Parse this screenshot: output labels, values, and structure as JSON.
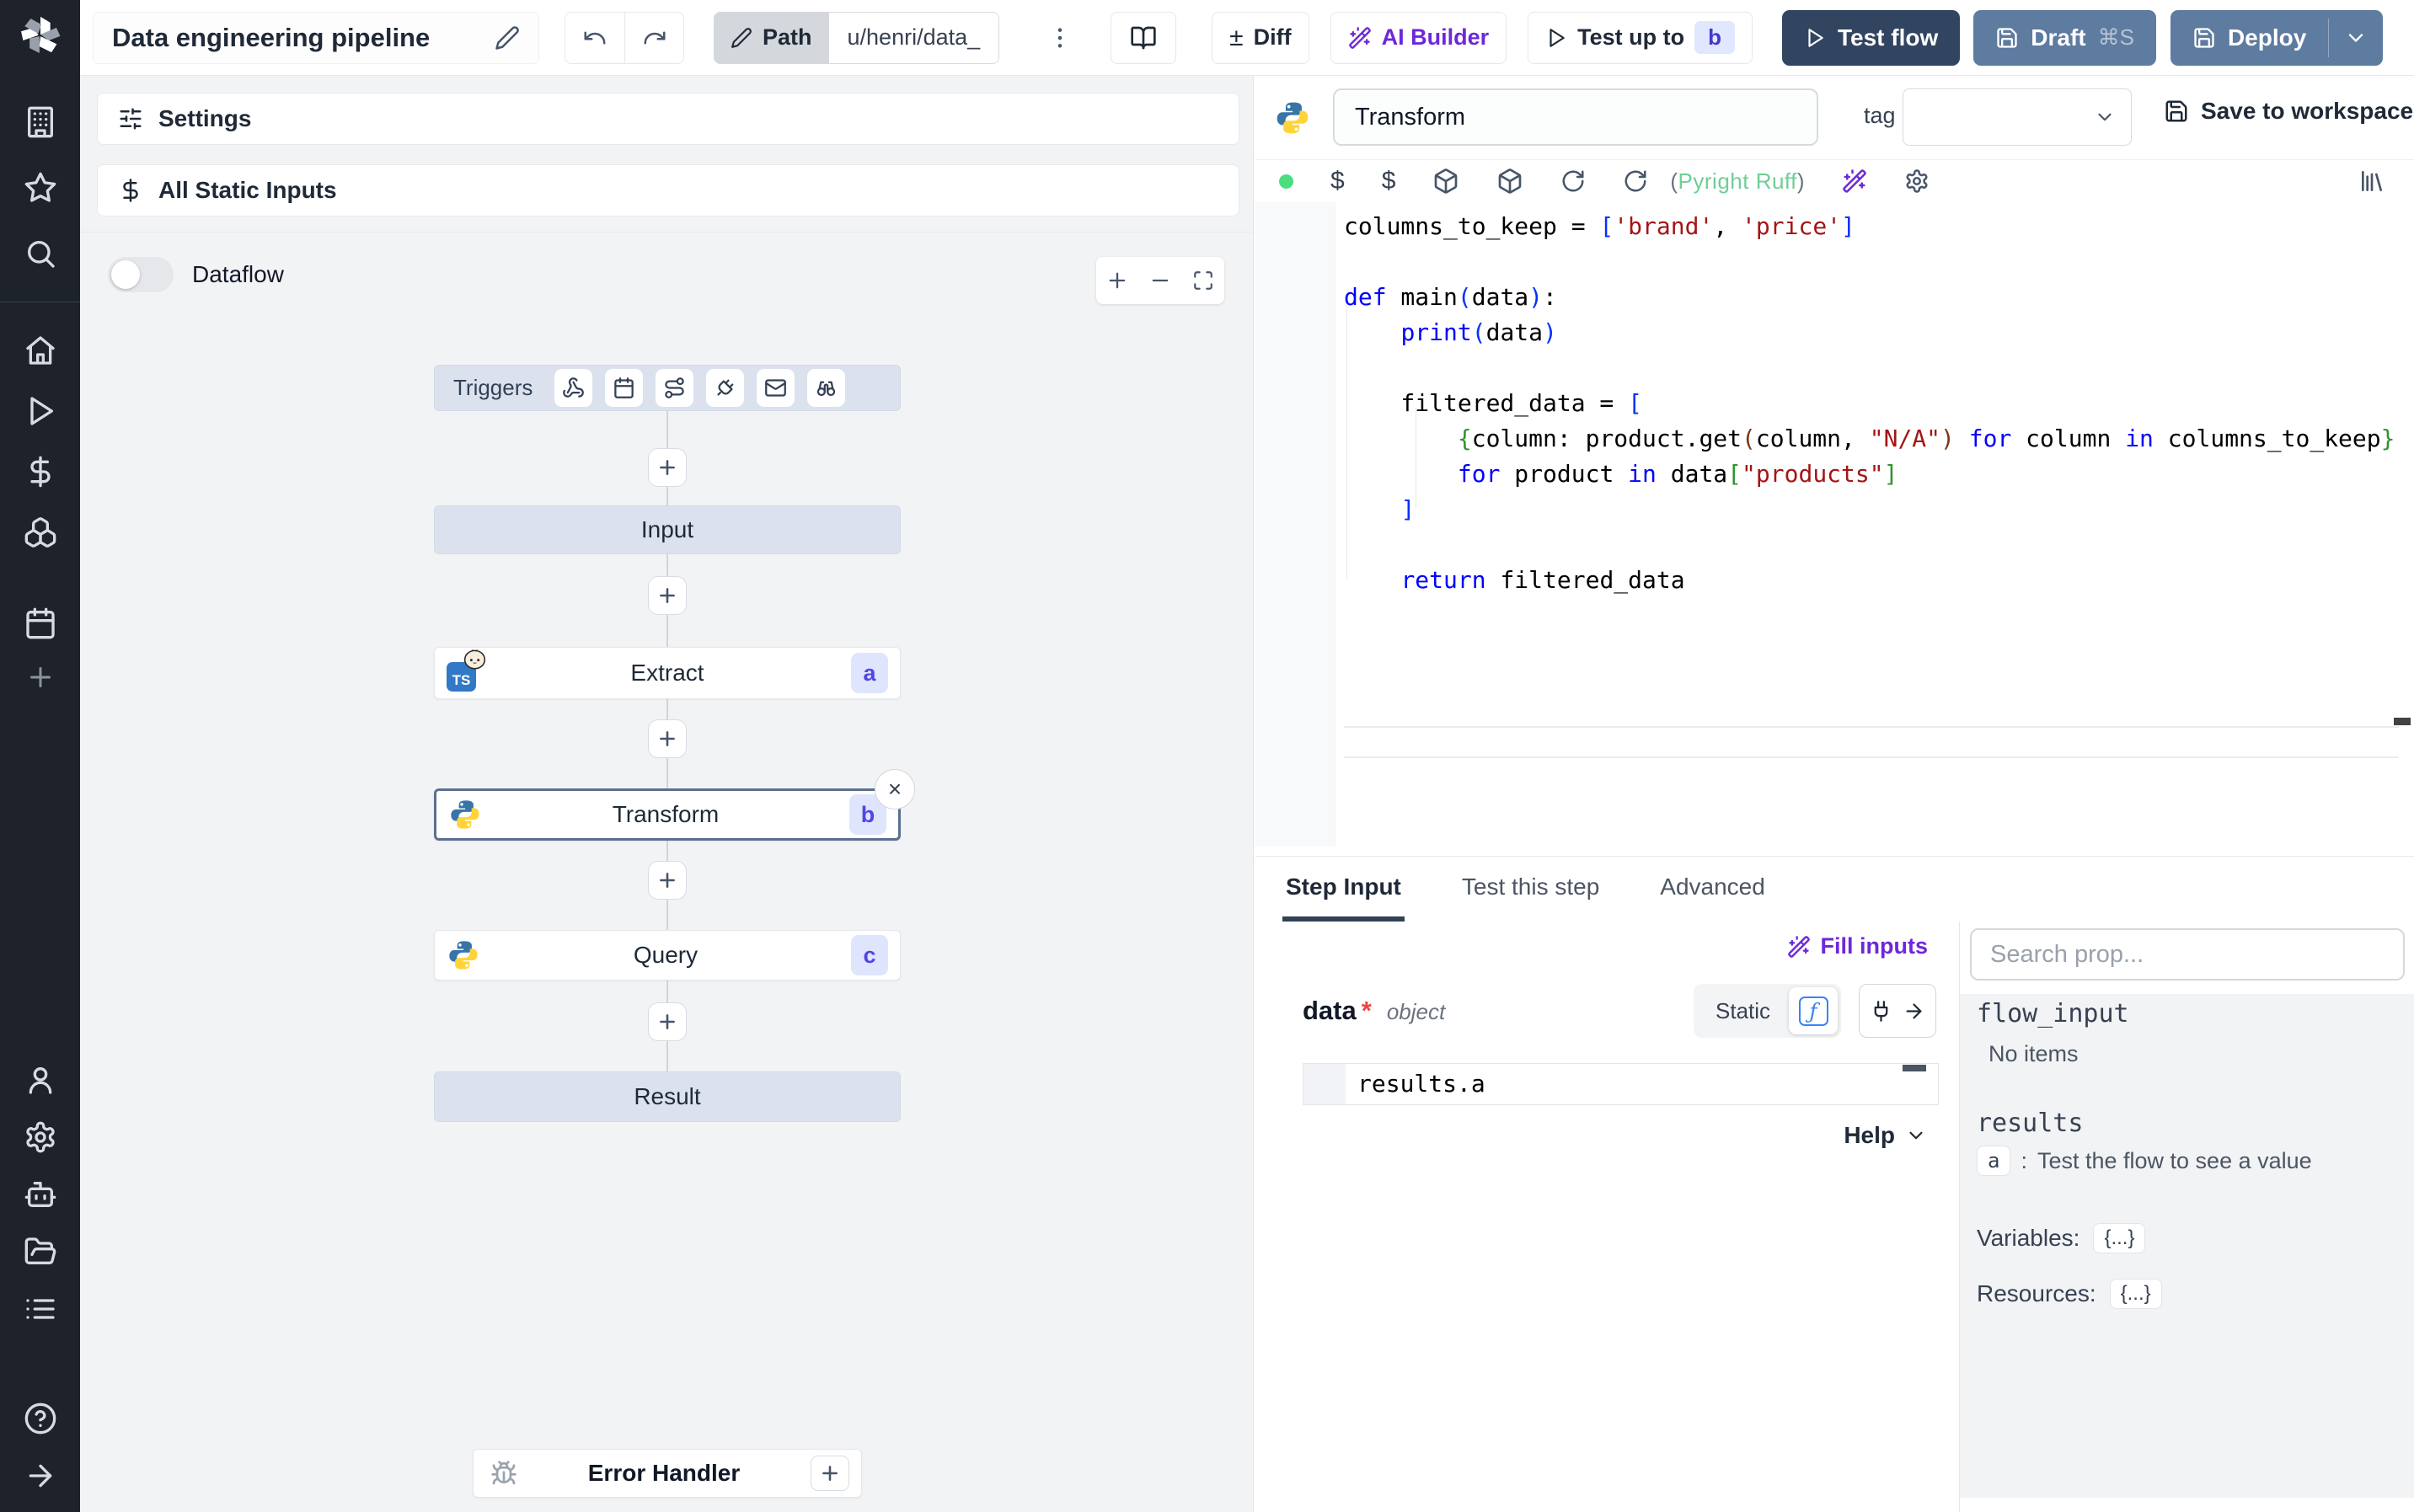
{
  "topbar": {
    "title": "Data engineering pipeline",
    "path_label": "Path",
    "path_value": "u/henri/data_",
    "diff_glyph": "±",
    "diff_label": "Diff",
    "ai_builder_label": "AI Builder",
    "test_up_to_label": "Test up to",
    "test_up_to_badge": "b",
    "test_flow_label": "Test flow",
    "draft_label": "Draft",
    "draft_shortcut": "⌘S",
    "deploy_label": "Deploy"
  },
  "flow": {
    "settings_label": "Settings",
    "static_inputs_label": "All Static Inputs",
    "dataflow_label": "Dataflow",
    "triggers_label": "Triggers",
    "input_label": "Input",
    "steps": {
      "extract": {
        "label": "Extract",
        "badge": "a",
        "lang": "bun-typescript"
      },
      "transform": {
        "label": "Transform",
        "badge": "b",
        "lang": "python",
        "selected": true
      },
      "query": {
        "label": "Query",
        "badge": "c",
        "lang": "python"
      }
    },
    "result_label": "Result",
    "error_handler_label": "Error Handler"
  },
  "editor": {
    "step_name": "Transform",
    "tag_label": "tag",
    "save_label": "Save to workspace",
    "lint_open": "(",
    "lint_name": "Pyright Ruff",
    "lint_close": ")",
    "code_lines": [
      [
        {
          "t": "columns_to_keep = "
        },
        {
          "t": "[",
          "c": "b1"
        },
        {
          "t": "'brand'",
          "c": "str"
        },
        {
          "t": ", "
        },
        {
          "t": "'price'",
          "c": "str"
        },
        {
          "t": "]",
          "c": "b1"
        }
      ],
      [],
      [
        {
          "t": "def",
          "c": "kw"
        },
        {
          "t": " main"
        },
        {
          "t": "(",
          "c": "b1"
        },
        {
          "t": "data"
        },
        {
          "t": ")",
          "c": "b1"
        },
        {
          "t": ":"
        }
      ],
      [
        {
          "t": "    "
        },
        {
          "t": "print",
          "c": "kw"
        },
        {
          "t": "(",
          "c": "b1"
        },
        {
          "t": "data"
        },
        {
          "t": ")",
          "c": "b1"
        }
      ],
      [],
      [
        {
          "t": "    filtered_data = "
        },
        {
          "t": "[",
          "c": "b1"
        }
      ],
      [
        {
          "t": "        "
        },
        {
          "t": "{",
          "c": "b2"
        },
        {
          "t": "column: product.get"
        },
        {
          "t": "(",
          "c": "b3"
        },
        {
          "t": "column, "
        },
        {
          "t": "\"N/A\"",
          "c": "str"
        },
        {
          "t": ")",
          "c": "b3"
        },
        {
          "t": " "
        },
        {
          "t": "for",
          "c": "kw"
        },
        {
          "t": " column "
        },
        {
          "t": "in",
          "c": "kw"
        },
        {
          "t": " columns_to_keep"
        },
        {
          "t": "}",
          "c": "b2"
        }
      ],
      [
        {
          "t": "        "
        },
        {
          "t": "for",
          "c": "kw"
        },
        {
          "t": " product "
        },
        {
          "t": "in",
          "c": "kw"
        },
        {
          "t": " data"
        },
        {
          "t": "[",
          "c": "b2"
        },
        {
          "t": "\"products\"",
          "c": "str"
        },
        {
          "t": "]",
          "c": "b2"
        }
      ],
      [
        {
          "t": "    "
        },
        {
          "t": "]",
          "c": "b1"
        }
      ],
      [],
      [
        {
          "t": "    "
        },
        {
          "t": "return",
          "c": "kw"
        },
        {
          "t": " filtered_data"
        }
      ]
    ]
  },
  "tabs": {
    "items": [
      {
        "label": "Step Input",
        "active": true
      },
      {
        "label": "Test this step",
        "active": false
      },
      {
        "label": "Advanced",
        "active": false
      }
    ]
  },
  "step_input": {
    "fill_inputs_label": "Fill inputs",
    "field_name": "data",
    "required_mark": "*",
    "field_type": "object",
    "static_label": "Static",
    "fn_glyph": "ƒ",
    "expression": "results.a",
    "help_label": "Help"
  },
  "props": {
    "search_placeholder": "Search prop...",
    "flow_input_label": "flow_input",
    "no_items_label": "No items",
    "results_label": "results",
    "result_key": "a",
    "result_sep": ":",
    "result_hint": "Test the flow to see a value",
    "variables_label": "Variables:",
    "variables_value": "{...}",
    "resources_label": "Resources:",
    "resources_value": "{...}"
  },
  "glyphs": {
    "ts": "TS",
    "close": "×"
  },
  "colors": {
    "sidebar_bg": "#1d222b",
    "canvas_bg": "#f2f3f5",
    "node_soft_bg": "#dbe2ee",
    "selected_border": "#5c6f8e",
    "badge_bg": "#dfe5fc",
    "badge_text": "#4f46e5",
    "test_flow_bg": "#314460",
    "deploy_bg": "#5e7ba0",
    "accent_purple": "#6d28d9",
    "status_green": "#4ade80",
    "code_keyword": "#0000ff",
    "code_string": "#a31515",
    "python_blue": "#3874a8",
    "python_yellow": "#ffd43b",
    "ts_blue": "#3178c6"
  }
}
